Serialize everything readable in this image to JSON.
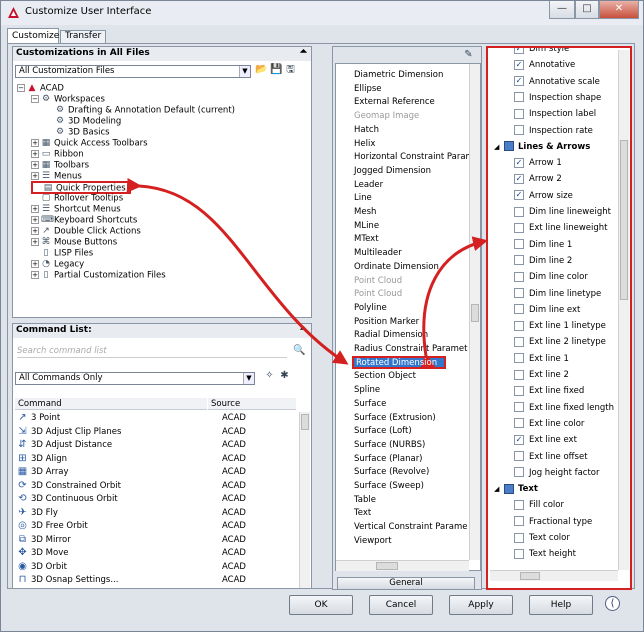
{
  "window": {
    "title": "Customize User Interface",
    "btn_min": "—",
    "btn_max": "□",
    "btn_close": "✕"
  },
  "tabs": [
    {
      "label": "Customize"
    },
    {
      "label": "Transfer"
    }
  ],
  "customizations": {
    "header": "Customizations in All Files",
    "combo": "All Customization Files",
    "tree": [
      {
        "label": "ACAD",
        "indent": 0,
        "expand": "−",
        "icon": "acad-icon"
      },
      {
        "label": "Workspaces",
        "indent": 1,
        "expand": "−",
        "icon": "workspaces-icon"
      },
      {
        "label": "Drafting & Annotation Default (current)",
        "indent": 2,
        "expand": "",
        "icon": "gear-icon"
      },
      {
        "label": "3D Modeling",
        "indent": 2,
        "expand": "",
        "icon": "gear-icon"
      },
      {
        "label": "3D Basics",
        "indent": 2,
        "expand": "",
        "icon": "gear-icon"
      },
      {
        "label": "Quick Access Toolbars",
        "indent": 1,
        "expand": "+",
        "icon": "toolbar-icon"
      },
      {
        "label": "Ribbon",
        "indent": 1,
        "expand": "+",
        "icon": "ribbon-icon"
      },
      {
        "label": "Toolbars",
        "indent": 1,
        "expand": "+",
        "icon": "toolbar-icon"
      },
      {
        "label": "Menus",
        "indent": 1,
        "expand": "+",
        "icon": "menu-icon"
      },
      {
        "label": "Quick Properties",
        "indent": 1,
        "expand": "",
        "icon": "quick-properties-icon"
      },
      {
        "label": "Rollover Tooltips",
        "indent": 1,
        "expand": "",
        "icon": "tooltip-icon"
      },
      {
        "label": "Shortcut Menus",
        "indent": 1,
        "expand": "+",
        "icon": "menu-icon"
      },
      {
        "label": "Keyboard Shortcuts",
        "indent": 1,
        "expand": "+",
        "icon": "keyboard-icon"
      },
      {
        "label": "Double Click Actions",
        "indent": 1,
        "expand": "+",
        "icon": "double-click-icon"
      },
      {
        "label": "Mouse Buttons",
        "indent": 1,
        "expand": "+",
        "icon": "mouse-icon"
      },
      {
        "label": "LISP Files",
        "indent": 1,
        "expand": "",
        "icon": "file-icon"
      },
      {
        "label": "Legacy",
        "indent": 1,
        "expand": "+",
        "icon": "legacy-icon"
      },
      {
        "label": "Partial Customization Files",
        "indent": 1,
        "expand": "+",
        "icon": "file-icon"
      }
    ]
  },
  "command_list": {
    "header": "Command List:",
    "search_placeholder": "Search command list",
    "filter": "All Commands Only",
    "col_command": "Command",
    "col_source": "Source",
    "rows": [
      {
        "command": "3 Point",
        "source": "ACAD"
      },
      {
        "command": "3D Adjust Clip Planes",
        "source": "ACAD"
      },
      {
        "command": "3D Adjust Distance",
        "source": "ACAD"
      },
      {
        "command": "3D Align",
        "source": "ACAD"
      },
      {
        "command": "3D Array",
        "source": "ACAD"
      },
      {
        "command": "3D Constrained Orbit",
        "source": "ACAD"
      },
      {
        "command": "3D Continuous Orbit",
        "source": "ACAD"
      },
      {
        "command": "3D Fly",
        "source": "ACAD"
      },
      {
        "command": "3D Free Orbit",
        "source": "ACAD"
      },
      {
        "command": "3D Mirror",
        "source": "ACAD"
      },
      {
        "command": "3D Move",
        "source": "ACAD"
      },
      {
        "command": "3D Orbit",
        "source": "ACAD"
      },
      {
        "command": "3D Osnap Settings...",
        "source": "ACAD"
      }
    ]
  },
  "object_types": {
    "items": [
      {
        "label": "Diametric Dimension",
        "gray": false
      },
      {
        "label": "Ellipse",
        "gray": false
      },
      {
        "label": "External Reference",
        "gray": false
      },
      {
        "label": "Geomap Image",
        "gray": true
      },
      {
        "label": "Hatch",
        "gray": false
      },
      {
        "label": "Helix",
        "gray": false
      },
      {
        "label": "Horizontal Constraint Param",
        "gray": false
      },
      {
        "label": "Jogged Dimension",
        "gray": false
      },
      {
        "label": "Leader",
        "gray": false
      },
      {
        "label": "Line",
        "gray": false
      },
      {
        "label": "Mesh",
        "gray": false
      },
      {
        "label": "MLine",
        "gray": false
      },
      {
        "label": "MText",
        "gray": false
      },
      {
        "label": "Multileader",
        "gray": false
      },
      {
        "label": "Ordinate Dimension",
        "gray": false
      },
      {
        "label": "Point Cloud",
        "gray": true
      },
      {
        "label": "Point Cloud",
        "gray": true
      },
      {
        "label": "Polyline",
        "gray": false
      },
      {
        "label": "Position Marker",
        "gray": false
      },
      {
        "label": "Radial Dimension",
        "gray": false
      },
      {
        "label": "Radius Constraint Paramet",
        "gray": false
      },
      {
        "label": "Rotated Dimension",
        "gray": false,
        "selected": true
      },
      {
        "label": "Section Object",
        "gray": false
      },
      {
        "label": "Spline",
        "gray": false
      },
      {
        "label": "Surface",
        "gray": false
      },
      {
        "label": "Surface (Extrusion)",
        "gray": false
      },
      {
        "label": "Surface (Loft)",
        "gray": false
      },
      {
        "label": "Surface (NURBS)",
        "gray": false
      },
      {
        "label": "Surface (Planar)",
        "gray": false
      },
      {
        "label": "Surface (Revolve)",
        "gray": false
      },
      {
        "label": "Surface (Sweep)",
        "gray": false
      },
      {
        "label": "Table",
        "gray": false
      },
      {
        "label": "Text",
        "gray": false
      },
      {
        "label": "Vertical Constraint Parame",
        "gray": false
      },
      {
        "label": "Viewport",
        "gray": false
      }
    ],
    "general_label": "General"
  },
  "properties": {
    "rows": [
      {
        "type": "prop",
        "label": "Dim style",
        "checked": true
      },
      {
        "type": "prop",
        "label": "Annotative",
        "checked": true
      },
      {
        "type": "prop",
        "label": "Annotative scale",
        "checked": true
      },
      {
        "type": "prop",
        "label": "Inspection shape",
        "checked": false
      },
      {
        "type": "prop",
        "label": "Inspection label",
        "checked": false
      },
      {
        "type": "prop",
        "label": "Inspection rate",
        "checked": false
      },
      {
        "type": "cat",
        "label": "Lines & Arrows"
      },
      {
        "type": "prop",
        "label": "Arrow 1",
        "checked": true
      },
      {
        "type": "prop",
        "label": "Arrow 2",
        "checked": true
      },
      {
        "type": "prop",
        "label": "Arrow size",
        "checked": true
      },
      {
        "type": "prop",
        "label": "Dim line lineweight",
        "checked": false
      },
      {
        "type": "prop",
        "label": "Ext line lineweight",
        "checked": false
      },
      {
        "type": "prop",
        "label": "Dim line 1",
        "checked": false
      },
      {
        "type": "prop",
        "label": "Dim line 2",
        "checked": false
      },
      {
        "type": "prop",
        "label": "Dim line color",
        "checked": false
      },
      {
        "type": "prop",
        "label": "Dim line linetype",
        "checked": false
      },
      {
        "type": "prop",
        "label": "Dim line ext",
        "checked": false
      },
      {
        "type": "prop",
        "label": "Ext line 1 linetype",
        "checked": false
      },
      {
        "type": "prop",
        "label": "Ext line 2 linetype",
        "checked": false
      },
      {
        "type": "prop",
        "label": "Ext line 1",
        "checked": false
      },
      {
        "type": "prop",
        "label": "Ext line 2",
        "checked": false
      },
      {
        "type": "prop",
        "label": "Ext line fixed",
        "checked": false
      },
      {
        "type": "prop",
        "label": "Ext line fixed length",
        "checked": false
      },
      {
        "type": "prop",
        "label": "Ext line color",
        "checked": false
      },
      {
        "type": "prop",
        "label": "Ext line ext",
        "checked": true
      },
      {
        "type": "prop",
        "label": "Ext line offset",
        "checked": false
      },
      {
        "type": "prop",
        "label": "Jog height factor",
        "checked": false
      },
      {
        "type": "cat",
        "label": "Text"
      },
      {
        "type": "prop",
        "label": "Fill color",
        "checked": false
      },
      {
        "type": "prop",
        "label": "Fractional type",
        "checked": false
      },
      {
        "type": "prop",
        "label": "Text color",
        "checked": false
      },
      {
        "type": "prop",
        "label": "Text height",
        "checked": false
      }
    ]
  },
  "buttons": {
    "ok": "OK",
    "cancel": "Cancel",
    "apply": "Apply",
    "help": "Help"
  },
  "colors": {
    "highlight_red": "#d42020",
    "selection_blue": "#3377cc"
  }
}
